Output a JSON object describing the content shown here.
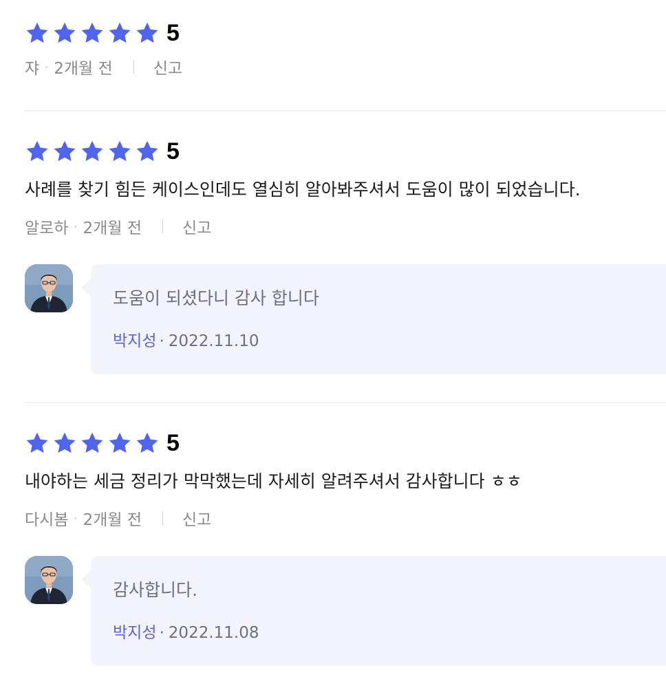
{
  "colors": {
    "star": "#5065ee",
    "author_accent": "#5b63e0",
    "bubble_bg": "#f3f4fb",
    "meta_gray": "#8a8a8a"
  },
  "reviews": [
    {
      "rating": 5,
      "score_label": "5",
      "text": "",
      "author": "쟈",
      "time": "2개월 전",
      "report_label": "신고"
    },
    {
      "rating": 5,
      "score_label": "5",
      "text": "사례를 찾기 힘든 케이스인데도 열심히 알아봐주셔서 도움이 많이 되었습니다.",
      "author": "알로하",
      "time": "2개월 전",
      "report_label": "신고",
      "reply": {
        "text": "도움이 되셨다니 감사 합니다",
        "author": "박지성",
        "date": "2022.11.10",
        "avatar_icon": "lawyer-avatar"
      }
    },
    {
      "rating": 5,
      "score_label": "5",
      "text": "내야하는 세금 정리가 막막했는데 자세히 알려주셔서 감사합니다 ㅎㅎ",
      "author": "다시봄",
      "time": "2개월 전",
      "report_label": "신고",
      "reply": {
        "text": "감사합니다.",
        "author": "박지성",
        "date": "2022.11.08",
        "avatar_icon": "lawyer-avatar"
      }
    }
  ],
  "separator_dot": "·"
}
